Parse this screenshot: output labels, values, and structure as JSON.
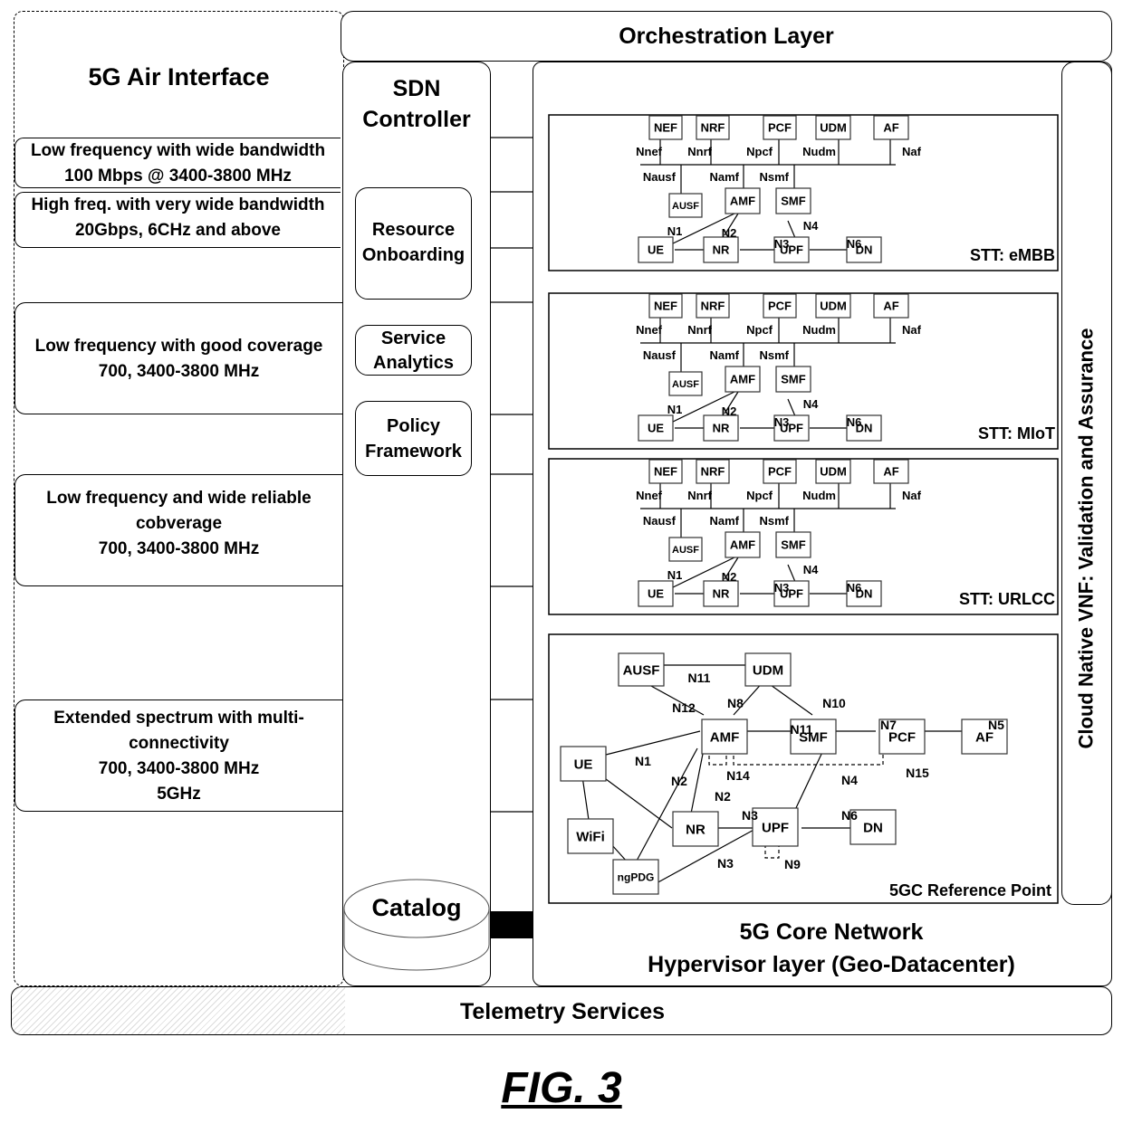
{
  "orchestration": {
    "label": "Orchestration Layer"
  },
  "air_interface": {
    "title": "5G Air Interface",
    "bands": [
      {
        "lines": [
          "Low frequency with wide bandwidth",
          "100 Mbps @ 3400-3800 MHz"
        ]
      },
      {
        "lines": [
          "High  freq. with very wide bandwidth",
          "20Gbps, 6CHz and above"
        ]
      },
      {
        "lines": [
          "Low frequency with good coverage",
          "700, 3400-3800 MHz"
        ]
      },
      {
        "lines": [
          "Low frequency and wide reliable",
          "cobverage",
          "700, 3400-3800 MHz"
        ]
      },
      {
        "lines": [
          "Extended spectrum with multi-",
          "connectivity",
          "700, 3400-3800 MHz",
          "5GHz"
        ]
      }
    ]
  },
  "sdn_controller": {
    "title_lines": [
      "SDN",
      "Controller"
    ],
    "modules": [
      {
        "lines": [
          "Resource",
          "Onboarding"
        ]
      },
      {
        "lines": [
          "Service",
          "Analytics"
        ]
      },
      {
        "lines": [
          "Policy",
          "Framework"
        ]
      }
    ],
    "catalog": "Catalog"
  },
  "core_network": {
    "title_lines": [
      "5G Core Network",
      "Hypervisor layer (Geo-Datacenter)"
    ],
    "validation_label": "Cloud Native VNF: Validation and Assurance",
    "slice_template": {
      "top_nfs": [
        "NEF",
        "NRF",
        "PCF",
        "UDM",
        "AF"
      ],
      "bus_labels": [
        "Nnef",
        "Nnrf",
        "Npcf",
        "Nudm",
        "Naf"
      ],
      "mid_labels": [
        "Nausf",
        "Namf",
        "Nsmf"
      ],
      "mid_nfs": [
        "AUSF",
        "AMF",
        "SMF"
      ],
      "bottom_nfs": [
        "UE",
        "NR",
        "UPF",
        "DN"
      ],
      "link_labels": [
        "N1",
        "N2",
        "N3",
        "N4",
        "N6"
      ]
    },
    "slices": [
      {
        "label": "STT: eMBB"
      },
      {
        "label": "STT: MIoT"
      },
      {
        "label": "STT: URLCC"
      }
    ],
    "reference_point": {
      "label": "5GC Reference Point",
      "nodes": [
        "AUSF",
        "UDM",
        "AMF",
        "SMF",
        "PCF",
        "AF",
        "UE",
        "WiFi",
        "NR",
        "UPF",
        "DN",
        "ngPDG"
      ],
      "links": [
        "N11",
        "N12",
        "N8",
        "N10",
        "N11",
        "N7",
        "N5",
        "N1",
        "N2",
        "N2",
        "N14",
        "N15",
        "N4",
        "N3",
        "N6",
        "N9",
        "N3"
      ]
    }
  },
  "telemetry": {
    "label": "Telemetry Services"
  },
  "figure_caption": "FIG. 3"
}
